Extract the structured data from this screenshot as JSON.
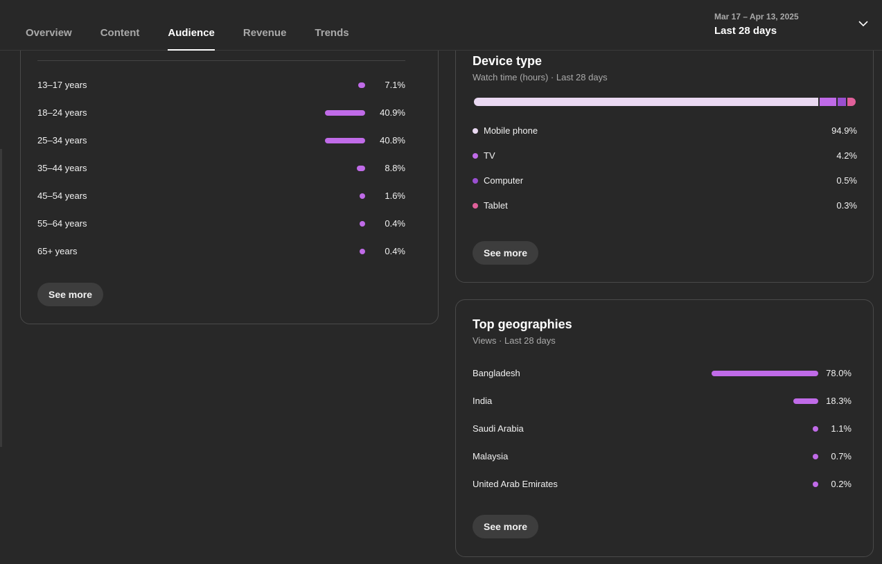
{
  "tabs": [
    {
      "label": "Overview",
      "active": false
    },
    {
      "label": "Content",
      "active": false
    },
    {
      "label": "Audience",
      "active": true
    },
    {
      "label": "Revenue",
      "active": false
    },
    {
      "label": "Trends",
      "active": false
    }
  ],
  "date_picker": {
    "range": "Mar 17 – Apr 13, 2025",
    "label": "Last 28 days",
    "icon": "chevron-down-icon"
  },
  "age": {
    "rows": [
      {
        "label": "13–17 years",
        "pct": "7.1%",
        "value": 7.1
      },
      {
        "label": "18–24 years",
        "pct": "40.9%",
        "value": 40.9
      },
      {
        "label": "25–34 years",
        "pct": "40.8%",
        "value": 40.8
      },
      {
        "label": "35–44 years",
        "pct": "8.8%",
        "value": 8.8
      },
      {
        "label": "45–54 years",
        "pct": "1.6%",
        "value": 1.6
      },
      {
        "label": "55–64 years",
        "pct": "0.4%",
        "value": 0.4
      },
      {
        "label": "65+ years",
        "pct": "0.4%",
        "value": 0.4
      }
    ],
    "see_more": "See more"
  },
  "device": {
    "title": "Device type",
    "subtitle": "Watch time (hours) · Last 28 days",
    "rows": [
      {
        "label": "Mobile phone",
        "pct": "94.9%",
        "value": 94.9,
        "color": "#ead9f2"
      },
      {
        "label": "TV",
        "pct": "4.2%",
        "value": 4.2,
        "color": "#c06be8"
      },
      {
        "label": "Computer",
        "pct": "0.5%",
        "value": 0.5,
        "color": "#9a4fd0"
      },
      {
        "label": "Tablet",
        "pct": "0.3%",
        "value": 0.3,
        "color": "#e0609a"
      }
    ],
    "see_more": "See more"
  },
  "geo": {
    "title": "Top geographies",
    "subtitle": "Views · Last 28 days",
    "rows": [
      {
        "label": "Bangladesh",
        "pct": "78.0%",
        "value": 78.0
      },
      {
        "label": "India",
        "pct": "18.3%",
        "value": 18.3
      },
      {
        "label": "Saudi Arabia",
        "pct": "1.1%",
        "value": 1.1
      },
      {
        "label": "Malaysia",
        "pct": "0.7%",
        "value": 0.7
      },
      {
        "label": "United Arab Emirates",
        "pct": "0.2%",
        "value": 0.2
      }
    ],
    "see_more": "See more"
  },
  "colors": {
    "bar": "#c06be8",
    "background": "#282828",
    "card_border": "#4a4a4a"
  }
}
